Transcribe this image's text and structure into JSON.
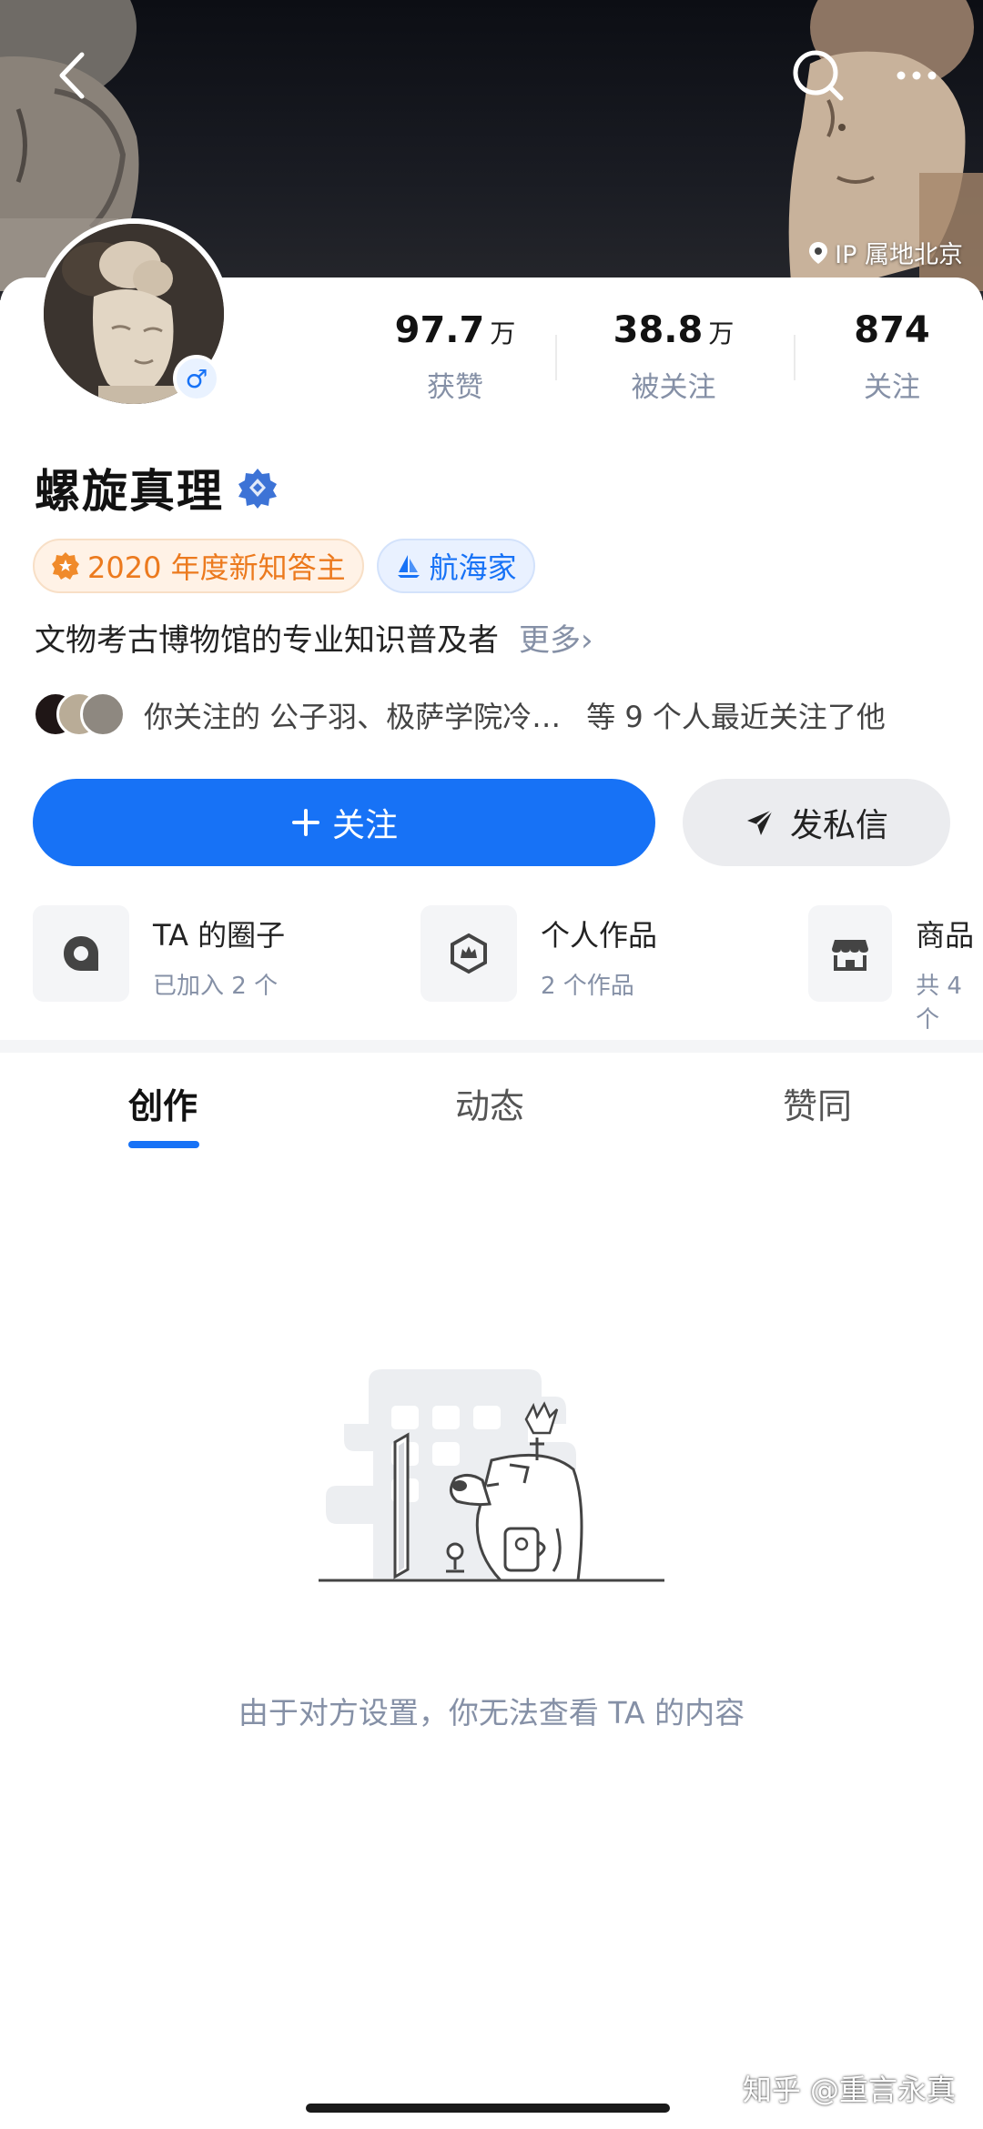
{
  "header": {
    "ip_location": "IP 属地北京"
  },
  "profile": {
    "name": "螺旋真理",
    "stats": [
      {
        "value": "97.7",
        "unit": "万",
        "label": "获赞"
      },
      {
        "value": "38.8",
        "unit": "万",
        "label": "被关注"
      },
      {
        "value": "874",
        "unit": "",
        "label": "关注"
      }
    ],
    "badges": [
      {
        "label": "2020 年度新知答主"
      },
      {
        "label": "航海家"
      }
    ],
    "bio": "文物考古博物馆的专业知识普及者",
    "bio_more": "更多›",
    "mutual_text": "你关注的 公子羽、极萨学院冷…",
    "mutual_suffix": "等 9 个人最近关注了他"
  },
  "actions": {
    "follow_label": "关注",
    "message_label": "发私信"
  },
  "shortcuts": [
    {
      "title": "TA 的圈子",
      "subtitle": "已加入 2 个"
    },
    {
      "title": "个人作品",
      "subtitle": "2 个作品"
    },
    {
      "title": "商品",
      "subtitle": "共 4 个"
    }
  ],
  "tabs": [
    {
      "label": "创作",
      "active": true
    },
    {
      "label": "动态",
      "active": false
    },
    {
      "label": "赞同",
      "active": false
    }
  ],
  "empty_state": {
    "message": "由于对方设置，你无法查看 TA 的内容"
  },
  "watermark": "知乎 @重言永真",
  "colors": {
    "accent": "#1772f6",
    "badge_orange": "#ec7a1e",
    "muted": "#8590a6"
  }
}
